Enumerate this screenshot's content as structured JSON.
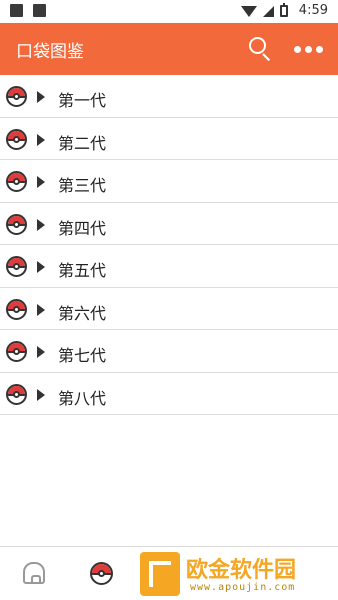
{
  "status_bar": {
    "time": "4:59"
  },
  "app_bar": {
    "title": "口袋图鉴",
    "search_icon": "search-icon",
    "more_icon": "more-dots-icon"
  },
  "list": {
    "items": [
      {
        "label": "第一代"
      },
      {
        "label": "第二代"
      },
      {
        "label": "第三代"
      },
      {
        "label": "第四代"
      },
      {
        "label": "第五代"
      },
      {
        "label": "第六代"
      },
      {
        "label": "第七代"
      },
      {
        "label": "第八代"
      }
    ]
  },
  "watermark": {
    "text": "欧金软件园",
    "url": "www.apoujin.com"
  },
  "colors": {
    "accent": "#f26a3c",
    "pokeball_red": "#e23b3b",
    "watermark": "#f5a623"
  }
}
